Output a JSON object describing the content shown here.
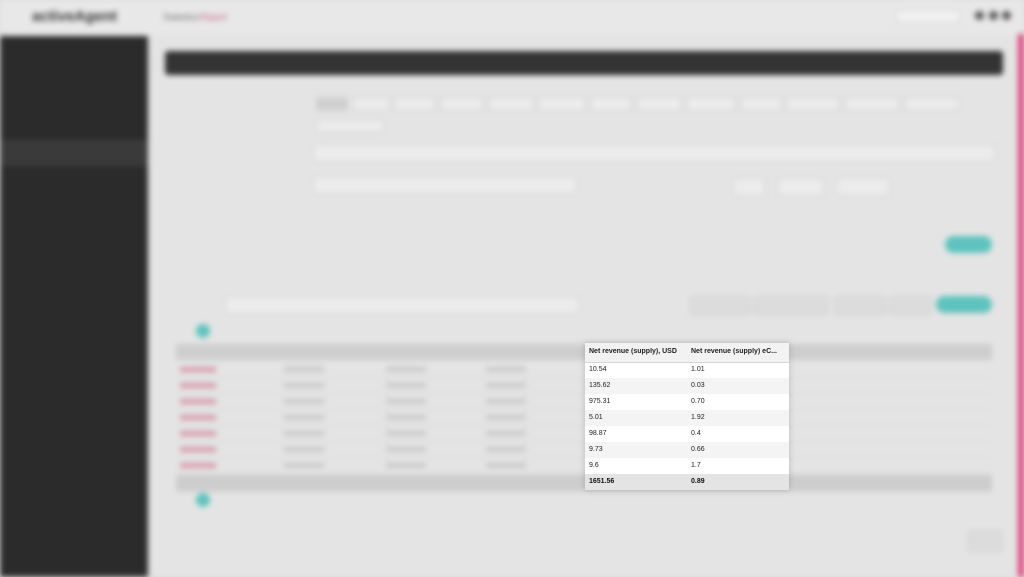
{
  "app": {
    "logo": "activeAgent",
    "breadcrumb": [
      "Statistics",
      "Report"
    ]
  },
  "popup": {
    "columns": [
      "Net revenue (supply), USD",
      "Net revenue (supply) eC..."
    ],
    "rows": [
      [
        "10.54",
        "1.01"
      ],
      [
        "135.62",
        "0.03"
      ],
      [
        "975.31",
        "0.70"
      ],
      [
        "5.01",
        "1.92"
      ],
      [
        "98.87",
        "0.4"
      ],
      [
        "9.73",
        "0.66"
      ],
      [
        "9.6",
        "1.7"
      ]
    ],
    "total": [
      "1651.56",
      "0.89"
    ]
  }
}
